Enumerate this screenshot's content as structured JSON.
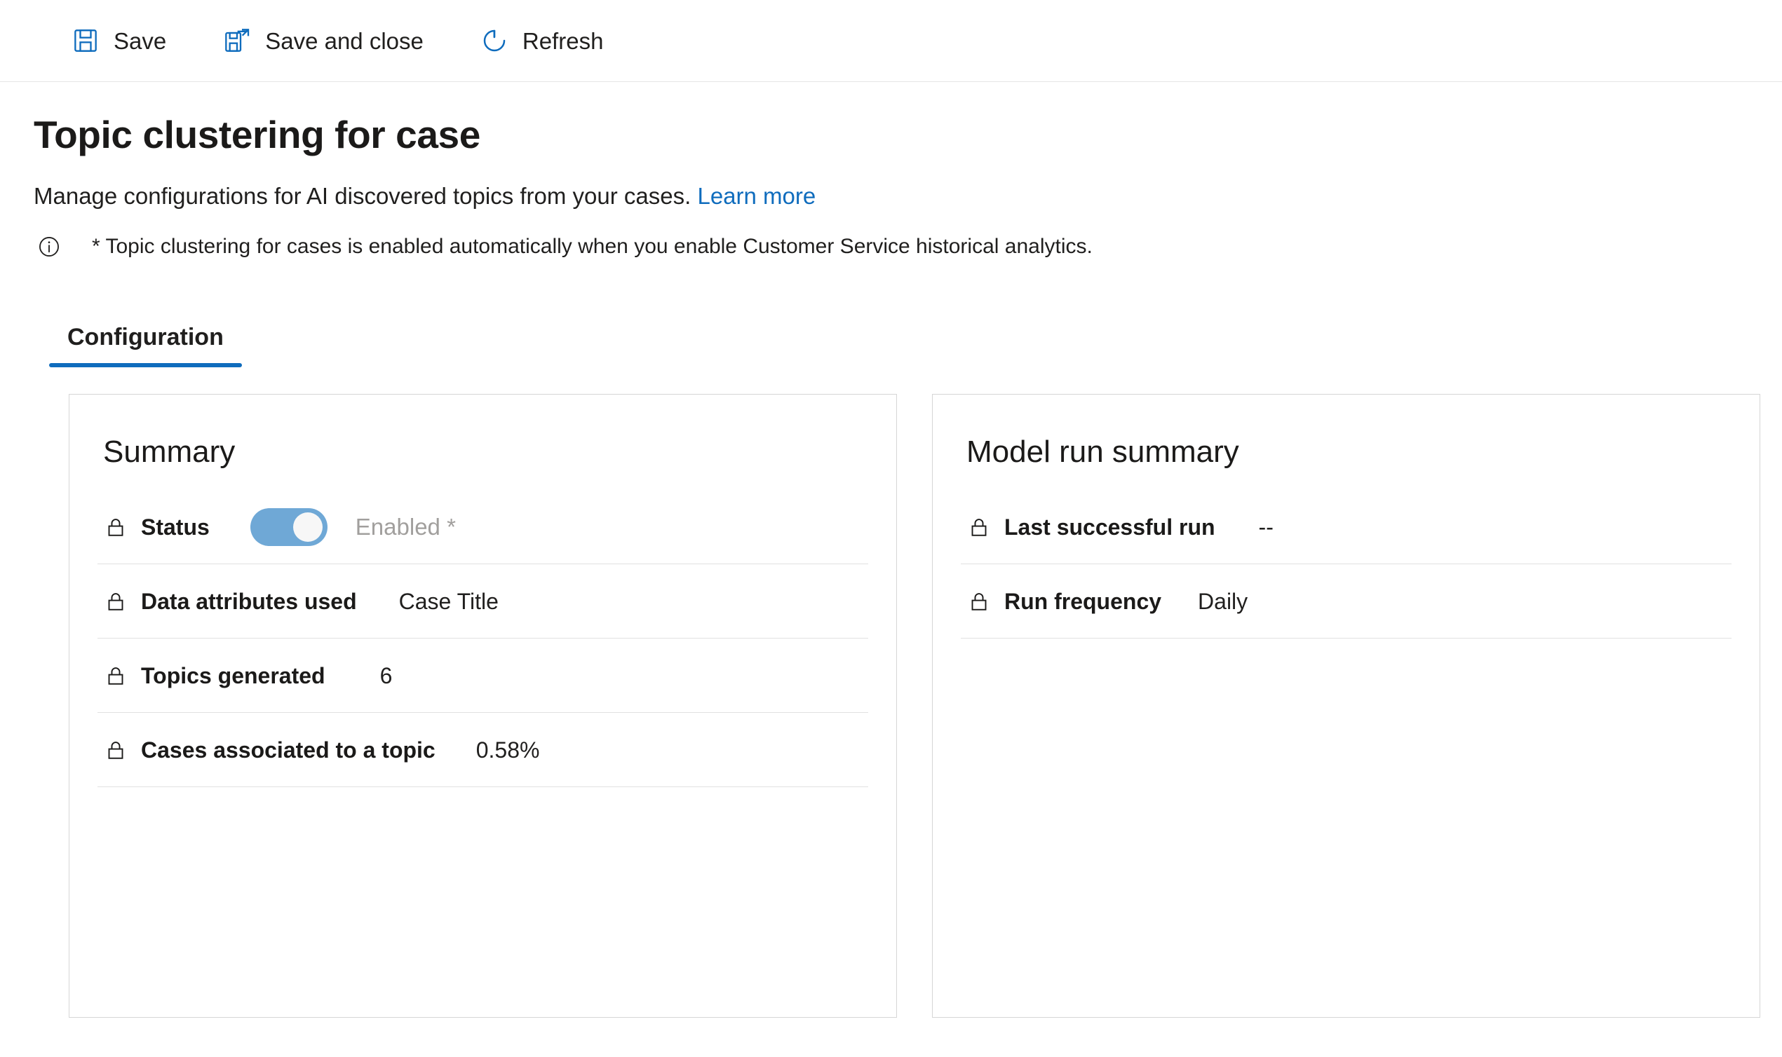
{
  "commandbar": {
    "buttons": [
      {
        "label": "Save",
        "icon": "save-icon"
      },
      {
        "label": "Save and close",
        "icon": "save-and-close-icon"
      },
      {
        "label": "Refresh",
        "icon": "refresh-icon"
      }
    ],
    "accent_color": "#0f6cbd"
  },
  "header": {
    "title": "Topic clustering for case",
    "description": "Manage configurations for AI discovered topics from your cases.",
    "learn_more_label": "Learn more",
    "note_icon": "info-icon",
    "note": "* Topic clustering for cases is enabled automatically when you enable Customer Service historical analytics."
  },
  "tabs": [
    {
      "label": "Configuration",
      "active": true
    }
  ],
  "cards": {
    "summary": {
      "title": "Summary",
      "status_row": {
        "lock_icon": "lock-icon",
        "label": "Status",
        "toggle_on": true,
        "toggle_label": "Enabled *"
      },
      "rows": [
        {
          "lock_icon": "lock-icon",
          "label": "Data attributes used",
          "value": "Case Title"
        },
        {
          "lock_icon": "lock-icon",
          "label": "Topics generated",
          "value": "6"
        },
        {
          "lock_icon": "lock-icon",
          "label": "Cases associated to a topic",
          "value": "0.58%"
        }
      ]
    },
    "model_run_summary": {
      "title": "Model run summary",
      "rows": [
        {
          "lock_icon": "lock-icon",
          "label": "Last successful run",
          "value": "--"
        },
        {
          "lock_icon": "lock-icon",
          "label": "Run frequency",
          "value": "Daily"
        }
      ]
    }
  },
  "colors": {
    "accent": "#0f6cbd",
    "toggle_on": "#6fa8d6",
    "muted_text": "#a19f9d",
    "card_border": "#d6d6d6"
  }
}
